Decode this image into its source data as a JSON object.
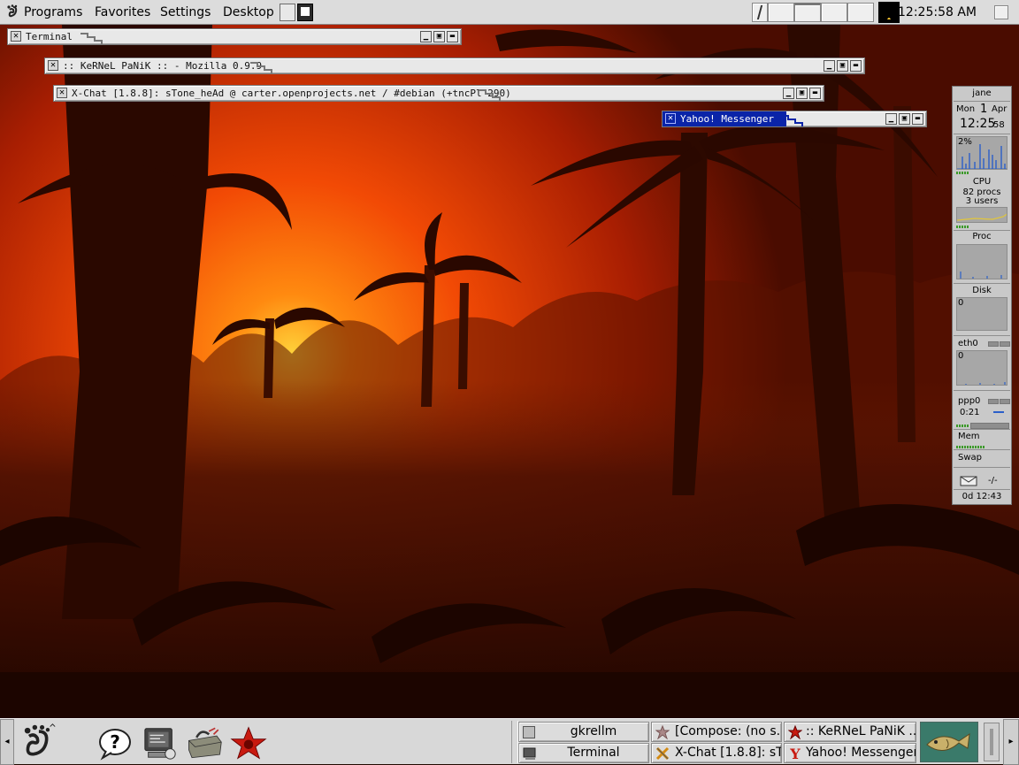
{
  "top_panel": {
    "menus": [
      "Programs",
      "Favorites",
      "Settings",
      "Desktop"
    ],
    "clock": "12:25:58 AM"
  },
  "windows": [
    {
      "title": "Terminal"
    },
    {
      "title": ":: KeRNeL PaNiK :: - Mozilla 0.9.9"
    },
    {
      "title": "X-Chat [1.8.8]: sTone_heAd @ carter.openprojects.net / #debian (+tncPl 290)"
    },
    {
      "title": "Yahoo! Messenger"
    }
  ],
  "gkrellm": {
    "hostname": "jane",
    "day": "Mon",
    "date_num": "1",
    "month": "Apr",
    "time_hm": "12:25",
    "time_sec": "58",
    "cpu_percent": "2%",
    "cpu_label": "CPU",
    "procs": "82 procs",
    "users": "3 users",
    "proc_label": "Proc",
    "disk_label": "Disk",
    "disk_value": "0",
    "eth0_label": "eth0",
    "eth0_value": "0",
    "ppp0_label": "ppp0",
    "ppp0_time": "0:21",
    "mem_label": "Mem",
    "swap_label": "Swap",
    "mail_count": "-/-",
    "uptime": "0d 12:43"
  },
  "tasklist": [
    {
      "label": "gkrellm"
    },
    {
      "label": "[Compose: (no s...]"
    },
    {
      "label": ":: KeRNeL PaNiK ..."
    },
    {
      "label": "Terminal"
    },
    {
      "label": "X-Chat [1.8.8]: sT..."
    },
    {
      "label": "Yahoo! Messenger"
    }
  ],
  "colors": {
    "panel_bg": "#dcdcdc",
    "active_title": "#0a24a8",
    "sky_orange": "#ff4a00",
    "gkrellm_led": "#3c9a2a"
  },
  "icons": {
    "menu": "gnome-foot-icon",
    "help": "help-icon",
    "terminal": "terminal-icon",
    "toolbox": "toolbox-icon",
    "star": "red-star-icon",
    "fish": "fish-applet-icon"
  }
}
